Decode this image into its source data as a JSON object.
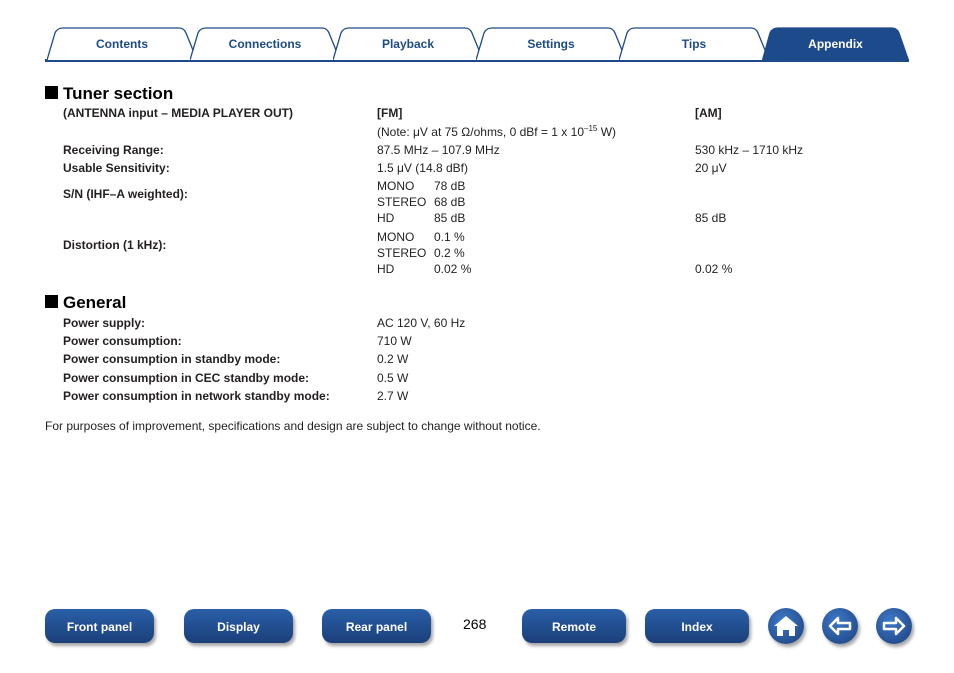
{
  "tabs": [
    {
      "label": "Contents"
    },
    {
      "label": "Connections"
    },
    {
      "label": "Playback"
    },
    {
      "label": "Settings"
    },
    {
      "label": "Tips"
    },
    {
      "label": "Appendix"
    }
  ],
  "tuner": {
    "heading": "Tuner section",
    "col_label": "(ANTENNA input – MEDIA PLAYER OUT)",
    "col_fm": "[FM]",
    "col_am": "[AM]",
    "note_pre": "(Note: μV at 75 Ω/ohms, 0 dBf = 1 x 10",
    "note_sup": "–15",
    "note_post": " W)",
    "receiving_label": "Receiving Range:",
    "receiving_fm": "87.5 MHz – 107.9 MHz",
    "receiving_am": "530 kHz – 1710 kHz",
    "usable_label": "Usable Sensitivity:",
    "usable_fm": "1.5 μV (14.8 dBf)",
    "usable_am": "20 μV",
    "sn_label": "S/N (IHF–A weighted):",
    "sn_rows": [
      {
        "mode": "MONO",
        "fm": "78 dB",
        "am": ""
      },
      {
        "mode": "STEREO",
        "fm": "68 dB",
        "am": ""
      },
      {
        "mode": "HD",
        "fm": "85 dB",
        "am": "85 dB"
      }
    ],
    "dist_label": "Distortion (1 kHz):",
    "dist_rows": [
      {
        "mode": "MONO",
        "fm": "0.1 %",
        "am": ""
      },
      {
        "mode": "STEREO",
        "fm": "0.2 %",
        "am": ""
      },
      {
        "mode": "HD",
        "fm": "0.02 %",
        "am": "0.02 %"
      }
    ]
  },
  "general": {
    "heading": "General",
    "rows": [
      {
        "label": "Power supply:",
        "value": "AC 120 V, 60 Hz"
      },
      {
        "label": "Power consumption:",
        "value": "710 W"
      },
      {
        "label": "Power consumption in standby mode:",
        "value": "0.2 W"
      },
      {
        "label": "Power consumption in CEC standby mode:",
        "value": "0.5 W"
      },
      {
        "label": "Power consumption in network standby mode:",
        "value": "2.7 W"
      }
    ]
  },
  "notice": "For purposes of improvement, specifications and design are subject to change without notice.",
  "footer": {
    "front_panel": "Front panel",
    "display": "Display",
    "rear_panel": "Rear panel",
    "page": "268",
    "remote": "Remote",
    "index": "Index",
    "icons": [
      "home-icon",
      "back-arrow-icon",
      "forward-arrow-icon"
    ]
  },
  "colors": {
    "accent": "#1d4a8a",
    "tab_bg": "#ffffff",
    "button": "#2a5fa8"
  }
}
